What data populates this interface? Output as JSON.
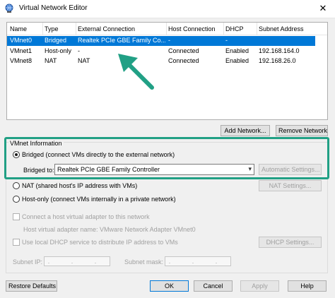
{
  "window": {
    "title": "Virtual Network Editor",
    "close_glyph": "✕"
  },
  "table": {
    "headers": [
      "Name",
      "Type",
      "External Connection",
      "Host Connection",
      "DHCP",
      "Subnet Address"
    ],
    "rows": [
      {
        "name": "VMnet0",
        "type": "Bridged",
        "external": "Realtek PCIe GBE Family Co...",
        "host": "-",
        "dhcp": "-",
        "subnet": "",
        "selected": true
      },
      {
        "name": "VMnet1",
        "type": "Host-only",
        "external": "-",
        "host": "Connected",
        "dhcp": "Enabled",
        "subnet": "192.168.164.0",
        "selected": false
      },
      {
        "name": "VMnet8",
        "type": "NAT",
        "external": "NAT",
        "host": "Connected",
        "dhcp": "Enabled",
        "subnet": "192.168.26.0",
        "selected": false
      }
    ]
  },
  "buttons": {
    "add_network": "Add Network...",
    "remove_network": "Remove Network",
    "automatic_settings": "Automatic Settings...",
    "nat_settings": "NAT Settings...",
    "dhcp_settings": "DHCP Settings...",
    "restore_defaults": "Restore Defaults",
    "ok": "OK",
    "cancel": "Cancel",
    "apply": "Apply",
    "help": "Help"
  },
  "info": {
    "legend": "VMnet Information",
    "bridged_label": "Bridged (connect VMs directly to the external network)",
    "bridged_to_label": "Bridged to:",
    "bridged_to_value": "Realtek PCIe GBE Family Controller",
    "nat_label": "NAT (shared host's IP address with VMs)",
    "hostonly_label": "Host-only (connect VMs internally in a private network)",
    "connect_adapter_label": "Connect a host virtual adapter to this network",
    "adapter_name_label": "Host virtual adapter name: VMware Network Adapter VMnet0",
    "dhcp_label": "Use local DHCP service to distribute IP address to VMs",
    "subnet_ip_label": "Subnet IP:",
    "subnet_mask_label": "Subnet mask:",
    "ip_placeholder": ". . ."
  },
  "colors": {
    "selection": "#0078d7",
    "annotation": "#21a085"
  }
}
